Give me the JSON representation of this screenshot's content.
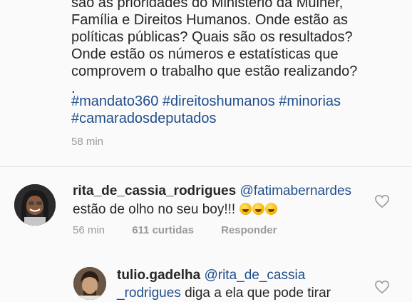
{
  "post": {
    "caption_lines": [
      "são as prioridades do Ministério da Mulher,",
      "Família e Direitos Humanos. Onde estão as",
      "políticas públicas? Quais são os resultados?",
      "Onde estão os números e estatísticas que",
      "comprovem o trabalho que estão realizando?",
      "."
    ],
    "hashtag_lines": [
      "#mandato360 #direitoshumanos #minorias",
      "#camaradosdeputados"
    ],
    "time": "58 min"
  },
  "comments": [
    {
      "username": "rita_de_cassia_rodrigues",
      "mention": "@fatimabernardes",
      "text": "estão de olho no seu boy!!!",
      "emoji": [
        "rolling-laughing",
        "rolling-laughing",
        "rolling-laughing"
      ],
      "time": "56 min",
      "likes": "611 curtidas",
      "reply": "Responder"
    },
    {
      "username": "tulio.gadelha",
      "mention_part1": "@rita_de_cassia",
      "mention_part2": "_rodrigues",
      "text": "diga a ela que pode tirar"
    }
  ],
  "icons": {
    "like": "heart-outline-icon"
  },
  "colors": {
    "mention": "#1f4d8c",
    "meta": "#9a9a9a",
    "background": "#fafafa"
  }
}
